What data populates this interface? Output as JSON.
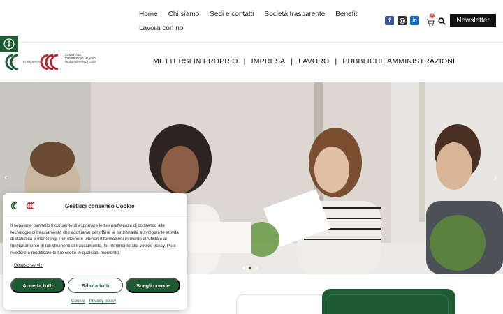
{
  "topnav": {
    "row1": [
      "Home",
      "Chi siamo",
      "Sedi e contatti",
      "Società trasparente",
      "Benefit"
    ],
    "row2": [
      "Lavora con noi"
    ]
  },
  "social": [
    "facebook-icon",
    "instagram-icon",
    "linkedin-icon"
  ],
  "cart": {
    "count": "0"
  },
  "newsletter_label": "Newsletter",
  "logo": {
    "left_text": "FORMAPER",
    "right_text": "CAMERA DI COMMERCIO MILANO MONZABRIANZA LODI"
  },
  "mainnav": [
    "METTERSI IN PROPRIO",
    "IMPRESA",
    "LAVORO",
    "PUBBLICHE AMMINISTRAZIONI"
  ],
  "hero": {
    "arrow_left": "‹",
    "arrow_right": "›",
    "slides": 3,
    "active_slide": 2
  },
  "consent": {
    "title": "Gestisci consenso Cookie",
    "body": "Il seguente pannello ti consente di esprimere le tue preferenze di consenso alle tecnologie di tracciamento che adottiamo per offrire le funzionalità e svolgere le attività di statistica e marketing. Per ottenere ulteriori informazioni in merito all'utilità e al funzionamento di tali strumenti di tracciamento, fai riferimento alla cookie policy. Puoi rivedere e modificare le tue scelte in qualsiasi momento.",
    "manage_label": "Gestisci servizi",
    "accept_label": "Accetta tutti",
    "deny_label": "Rifiuta tutti",
    "prefs_label": "Scegli cookie",
    "link_cookie": "Cookie",
    "link_privacy": "Privacy policy"
  },
  "colors": {
    "brand_green": "#1e5a32",
    "brand_red": "#b5262f"
  }
}
